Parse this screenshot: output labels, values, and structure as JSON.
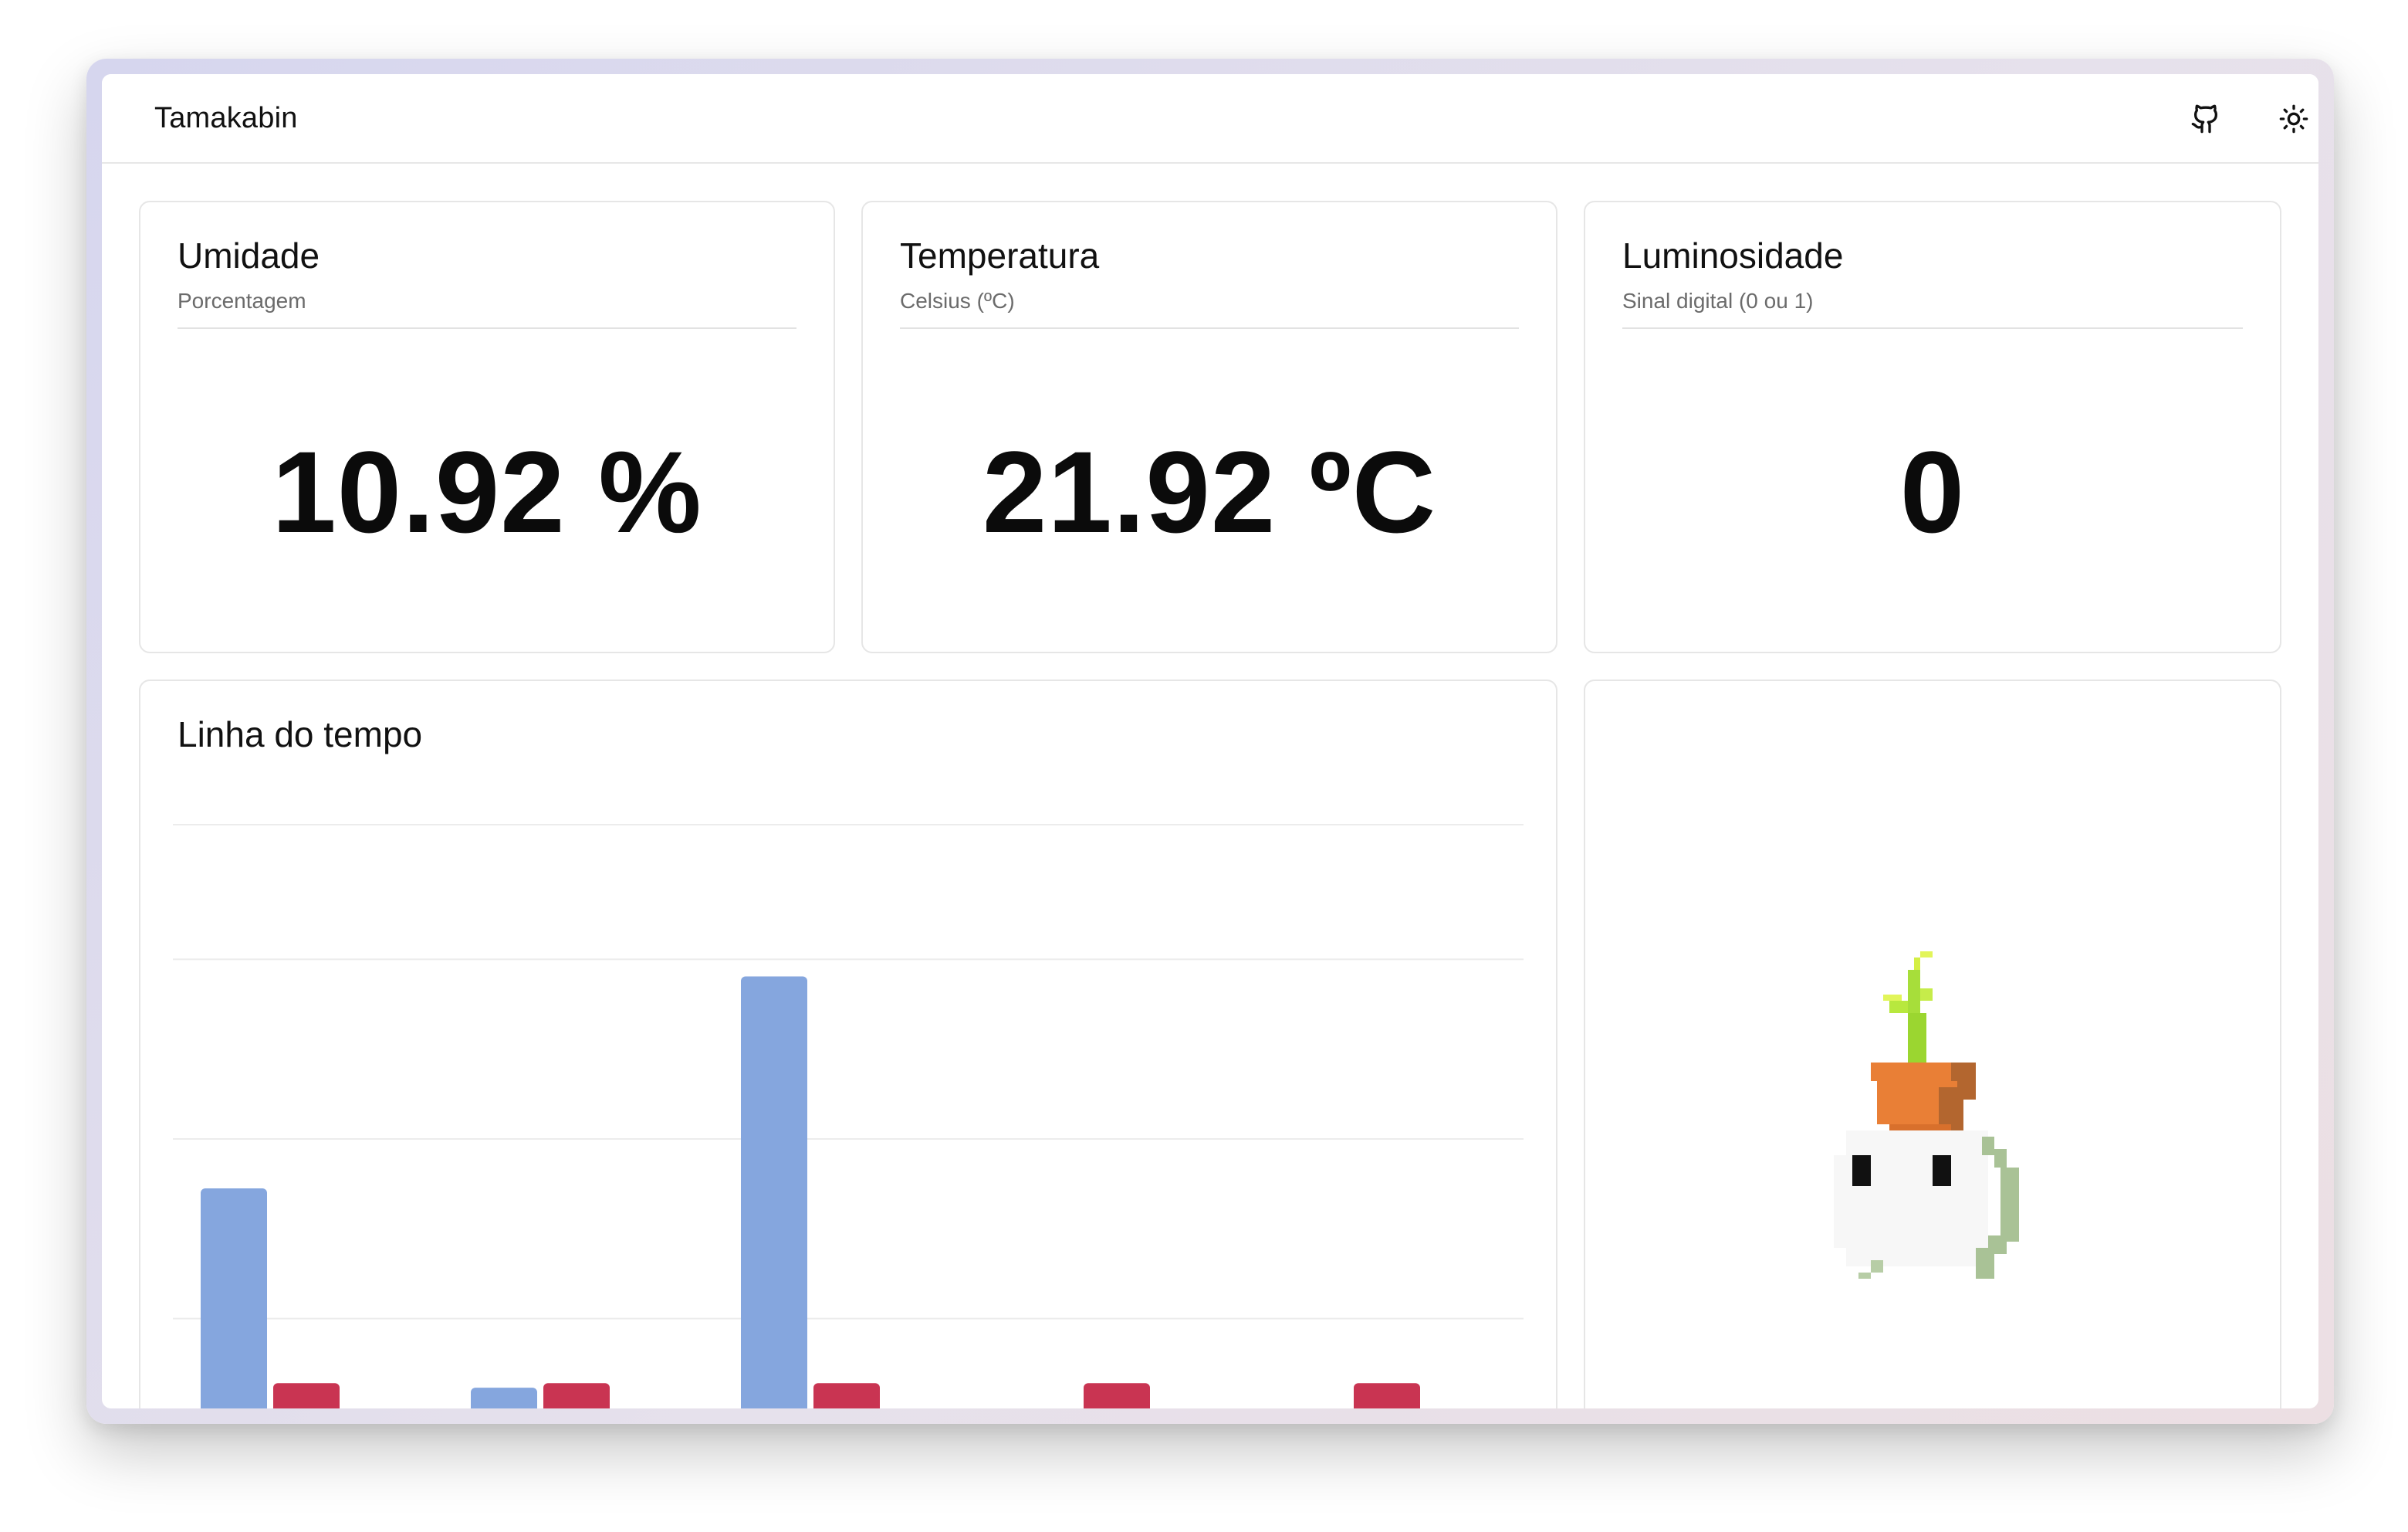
{
  "app": {
    "title": "Tamakabin"
  },
  "nav": {
    "github_icon": "github-icon",
    "theme_icon": "sun-icon"
  },
  "cards": {
    "humidity": {
      "title": "Umidade",
      "subtitle": "Porcentagem",
      "value": "10.92 %"
    },
    "temperature": {
      "title": "Temperatura",
      "subtitle": "Celsius (ºC)",
      "value": "21.92 ºC"
    },
    "light": {
      "title": "Luminosidade",
      "subtitle": "Sinal digital (0 ou 1)",
      "value": "0"
    }
  },
  "timeline": {
    "title": "Linha do tempo",
    "chart_data": {
      "type": "bar",
      "categories": [
        "",
        "",
        "",
        "",
        ""
      ],
      "series": [
        {
          "values": [
            29.5,
            7.3,
            53.1,
            0,
            0
          ]
        },
        {
          "values": [
            7.8,
            7.8,
            7.8,
            7.8,
            7.8
          ]
        }
      ],
      "ylim": [
        0,
        70
      ],
      "grid": true,
      "colors": [
        "#85a6de",
        "#c93452"
      ]
    }
  },
  "mascot": {
    "icon": "pixel-plant-pot-ghost"
  }
}
